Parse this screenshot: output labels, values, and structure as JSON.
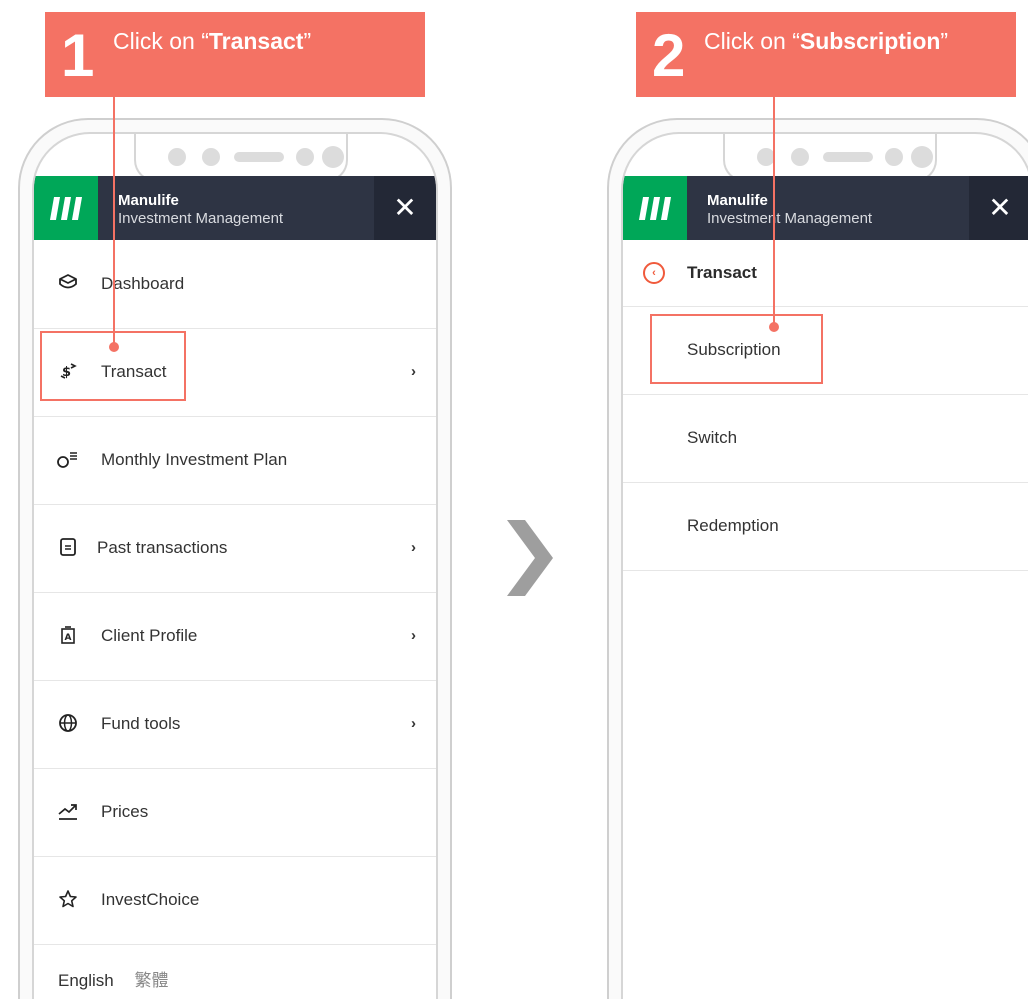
{
  "steps": [
    {
      "number": "1",
      "prefix": "Click on “",
      "target": "Transact",
      "suffix": "”"
    },
    {
      "number": "2",
      "prefix": "Click on “",
      "target": "Subscription",
      "suffix": "”"
    }
  ],
  "app": {
    "brand_name": "Manulife",
    "brand_sub": "Investment Management",
    "close_symbol": "✕",
    "green": "#00a758",
    "bar_color": "#2e3444",
    "accent": "#f47264"
  },
  "menu": [
    {
      "label": "Dashboard",
      "icon": "box-icon",
      "chevron": ""
    },
    {
      "label": "Transact",
      "icon": "dollar-exchange-icon",
      "chevron": "›"
    },
    {
      "label": "Monthly Investment Plan",
      "icon": "coin-list-icon",
      "chevron": ""
    },
    {
      "label": "Past transactions",
      "icon": "document-icon",
      "chevron": "›"
    },
    {
      "label": "Client Profile",
      "icon": "profile-card-icon",
      "chevron": "›"
    },
    {
      "label": "Fund tools",
      "icon": "globe-icon",
      "chevron": "›"
    },
    {
      "label": "Prices",
      "icon": "trend-up-icon",
      "chevron": ""
    },
    {
      "label": "InvestChoice",
      "icon": "star-icon",
      "chevron": ""
    }
  ],
  "languages": [
    "English",
    "繁體"
  ],
  "submenu": {
    "title": "Transact",
    "items": [
      "Subscription",
      "Switch",
      "Redemption"
    ]
  }
}
